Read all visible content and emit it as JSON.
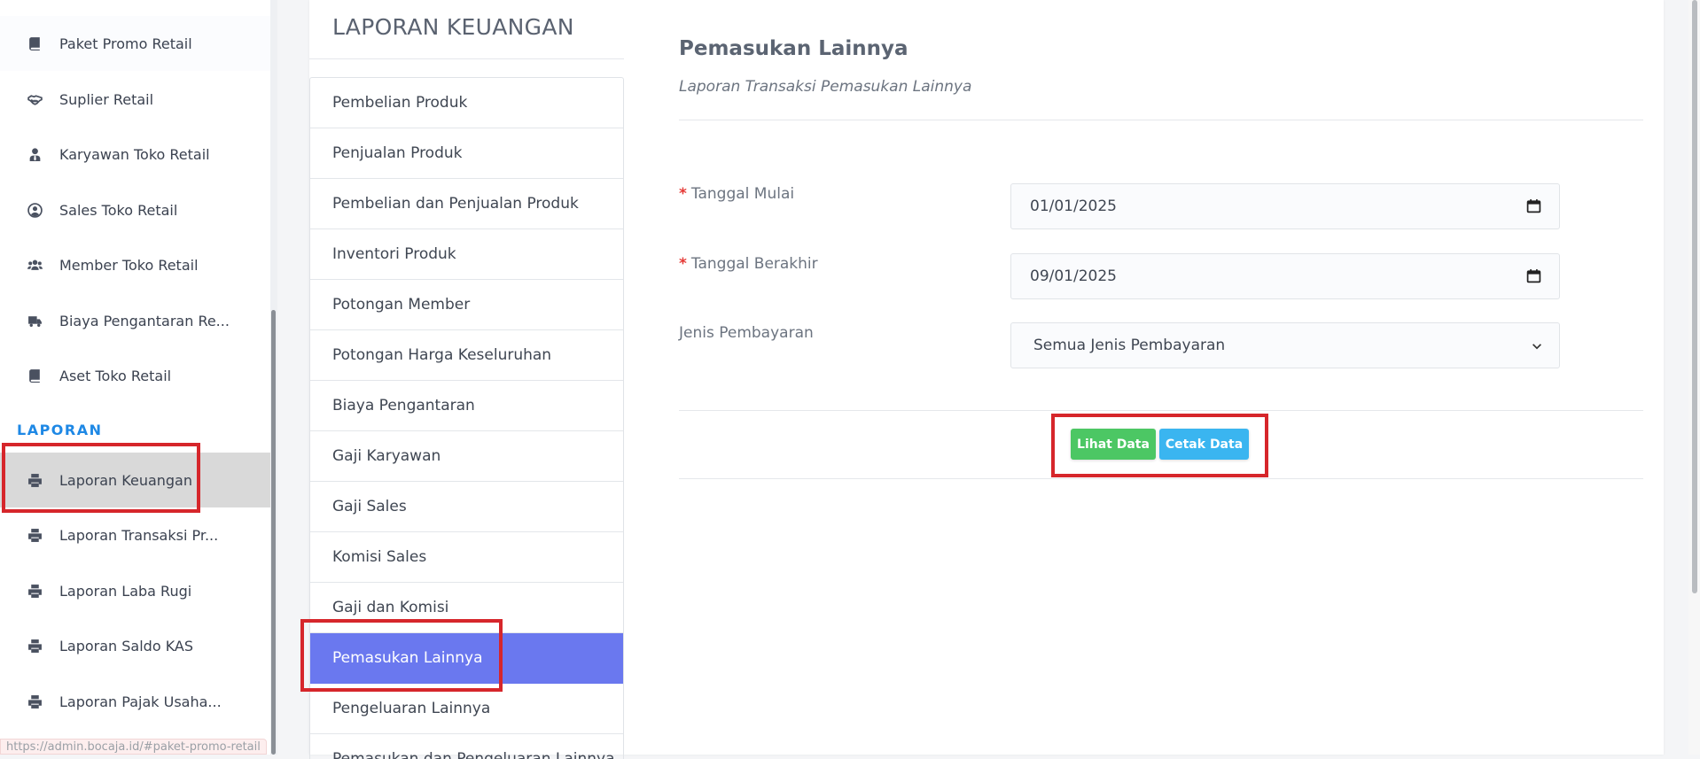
{
  "sidebar": {
    "items": [
      {
        "label": "Paket Promo Retail",
        "icon": "book-icon"
      },
      {
        "label": "Suplier Retail",
        "icon": "handshake-icon"
      },
      {
        "label": "Karyawan Toko Retail",
        "icon": "user-tie-icon"
      },
      {
        "label": "Sales Toko Retail",
        "icon": "user-circle-icon"
      },
      {
        "label": "Member Toko Retail",
        "icon": "users-icon"
      },
      {
        "label": "Biaya Pengantaran Re...",
        "icon": "truck-icon"
      },
      {
        "label": "Aset Toko Retail",
        "icon": "book-icon"
      }
    ],
    "section_label": "LAPORAN",
    "report_items": [
      {
        "label": "Laporan Keuangan",
        "icon": "printer-icon",
        "active": true
      },
      {
        "label": "Laporan Transaksi Pr...",
        "icon": "printer-icon"
      },
      {
        "label": "Laporan Laba Rugi",
        "icon": "printer-icon"
      },
      {
        "label": "Laporan Saldo KAS",
        "icon": "printer-icon"
      },
      {
        "label": "Laporan Pajak Usaha...",
        "icon": "printer-icon"
      }
    ]
  },
  "status_url": "https://admin.bocaja.id/#paket-promo-retail",
  "report": {
    "title": "LAPORAN KEUANGAN",
    "menu": [
      "Pembelian Produk",
      "Penjualan Produk",
      "Pembelian dan Penjualan Produk",
      "Inventori Produk",
      "Potongan Member",
      "Potongan Harga Keseluruhan",
      "Biaya Pengantaran",
      "Gaji Karyawan",
      "Gaji Sales",
      "Komisi Sales",
      "Gaji dan Komisi",
      "Pemasukan Lainnya",
      "Pengeluaran Lainnya",
      "Pemasukan dan Pengeluaran Lainnya"
    ],
    "active_menu": "Pemasukan Lainnya"
  },
  "form": {
    "title": "Pemasukan Lainnya",
    "subtitle": "Laporan Transaksi Pemasukan Lainnya",
    "required_mark": "*",
    "start_label": "Tanggal Mulai",
    "start_value": "01/01/2025",
    "end_label": "Tanggal Berakhir",
    "end_value": "09/01/2025",
    "payment_label": "Jenis Pembayaran",
    "payment_value": "Semua Jenis Pembayaran",
    "view_button": "Lihat Data",
    "print_button": "Cetak Data"
  },
  "colors": {
    "accent": "#6a78ef",
    "section": "#1e88e5",
    "view_button": "#4cc764",
    "print_button": "#3ab5f0",
    "highlight": "#d6262b"
  }
}
